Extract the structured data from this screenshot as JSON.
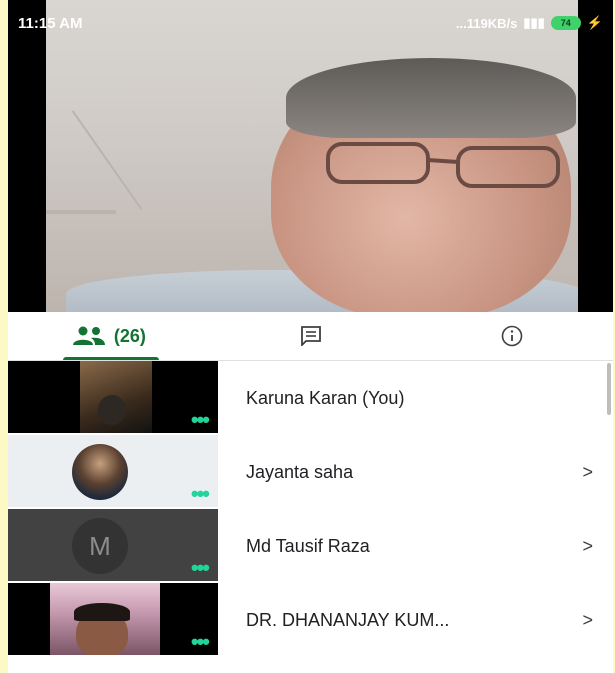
{
  "status_bar": {
    "time": "11:15 AM",
    "network_speed": "...119KB/s",
    "battery": "74"
  },
  "tabs": {
    "people_count": "(26)",
    "people_icon": "people-icon",
    "chat_icon": "chat-icon",
    "info_icon": "info-icon"
  },
  "participants": [
    {
      "name": "Karuna Karan (You)",
      "has_chevron": false,
      "thumb": "video"
    },
    {
      "name": "Jayanta saha",
      "has_chevron": true,
      "thumb": "avatar-photo"
    },
    {
      "name": "Md Tausif Raza",
      "has_chevron": true,
      "thumb": "initial",
      "initial": "M"
    },
    {
      "name": "DR. DHANANJAY KUM...",
      "has_chevron": true,
      "thumb": "video"
    }
  ],
  "chevron_glyph": ">",
  "colors": {
    "accent": "#137333",
    "dots": "#22d39a"
  }
}
